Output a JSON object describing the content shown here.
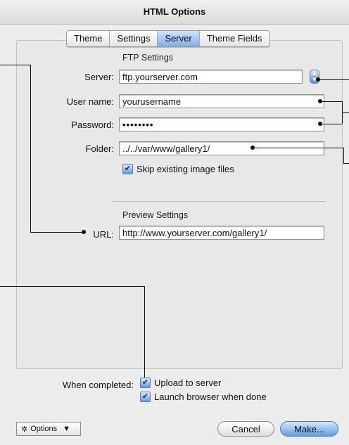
{
  "window": {
    "title": "HTML Options"
  },
  "tabs": [
    {
      "label": "Theme",
      "active": false
    },
    {
      "label": "Settings",
      "active": false
    },
    {
      "label": "Server",
      "active": true
    },
    {
      "label": "Theme Fields",
      "active": false
    }
  ],
  "ftp": {
    "heading": "FTP Settings",
    "server_label": "Server:",
    "server_value": "ftp.yourserver.com",
    "username_label": "User name:",
    "username_value": "yourusername",
    "password_label": "Password:",
    "password_value": "••••••••",
    "folder_label": "Folder:",
    "folder_value": "../../var/www/gallery1/",
    "skip_label": "Skip existing image files",
    "skip_checked": true
  },
  "preview": {
    "heading": "Preview Settings",
    "url_label": "URL:",
    "url_value": "http://www.yourserver.com/gallery1/"
  },
  "completion": {
    "label": "When completed:",
    "upload_label": "Upload to server",
    "upload_checked": true,
    "launch_label": "Launch browser when done",
    "launch_checked": true
  },
  "footer": {
    "options_label": "Options",
    "cancel_label": "Cancel",
    "make_label": "Make..."
  },
  "icons": {
    "gear": "gear-icon",
    "dropdown": "chevron-down-icon",
    "stepper": "stepper-icon",
    "check": "checkmark-icon"
  },
  "colors": {
    "accent": "#5c9fe6",
    "window_bg": "#ececec"
  }
}
